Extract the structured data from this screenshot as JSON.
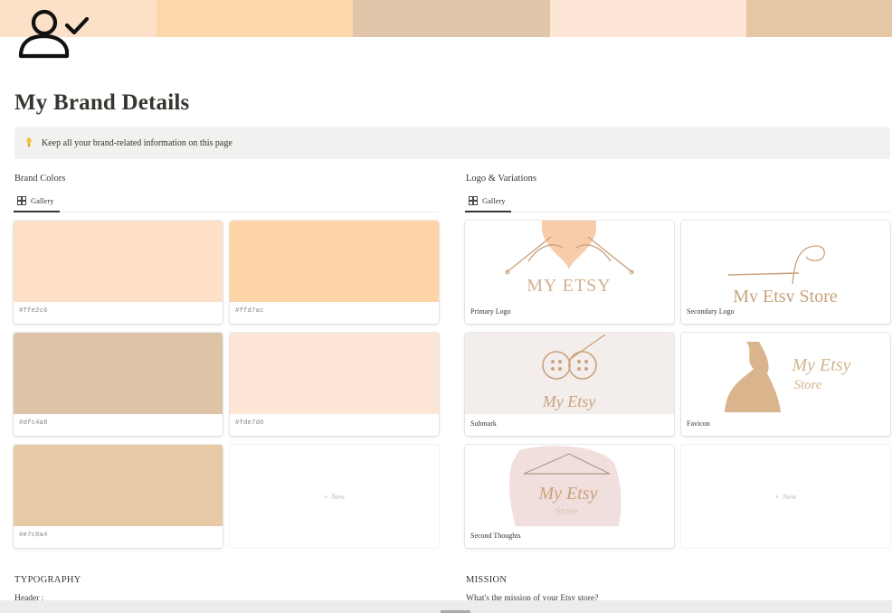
{
  "cover": {
    "colors": [
      "#fce1c8",
      "#fdd8ab",
      "#e1c6a9",
      "#fde6d6",
      "#e5c7a6"
    ]
  },
  "page": {
    "icon": "user-check-icon",
    "title": "My Brand Details"
  },
  "callout": {
    "icon": "lightbulb-icon",
    "text": "Keep all your brand-related information on this page"
  },
  "brand_colors": {
    "heading": "Brand Colors",
    "view_tab": "Gallery",
    "cards": [
      {
        "label": "#ffe2c6",
        "color": "#fee0c6"
      },
      {
        "label": "#ffd7ac",
        "color": "#ffd5a8"
      },
      {
        "label": "#dfc4a8",
        "color": "#dec4a6"
      },
      {
        "label": "#fde7d6",
        "color": "#fde6d6"
      },
      {
        "label": "#e7c8a4",
        "color": "#e7c9a6"
      }
    ],
    "new_label": "New"
  },
  "logos": {
    "heading": "Logo & Variations",
    "view_tab": "Gallery",
    "cards": [
      {
        "label": "Primary Logo",
        "logo_text": "MY ETSY"
      },
      {
        "label": "Secondary Logo",
        "logo_text": "My Etsy Store"
      },
      {
        "label": "Submark",
        "logo_text": "My Etsy"
      },
      {
        "label": "Favicon",
        "logo_text_1": "My Etsy",
        "logo_text_2": "Store"
      },
      {
        "label": "Second Thoughts",
        "logo_text_1": "My Etsy",
        "logo_text_2": "Store"
      }
    ],
    "new_label": "New"
  },
  "typography": {
    "heading": "TYPOGRAPHY",
    "first_item": "Header :"
  },
  "mission": {
    "heading": "MISSION",
    "question": "What's the mission of your Etsy store?"
  }
}
